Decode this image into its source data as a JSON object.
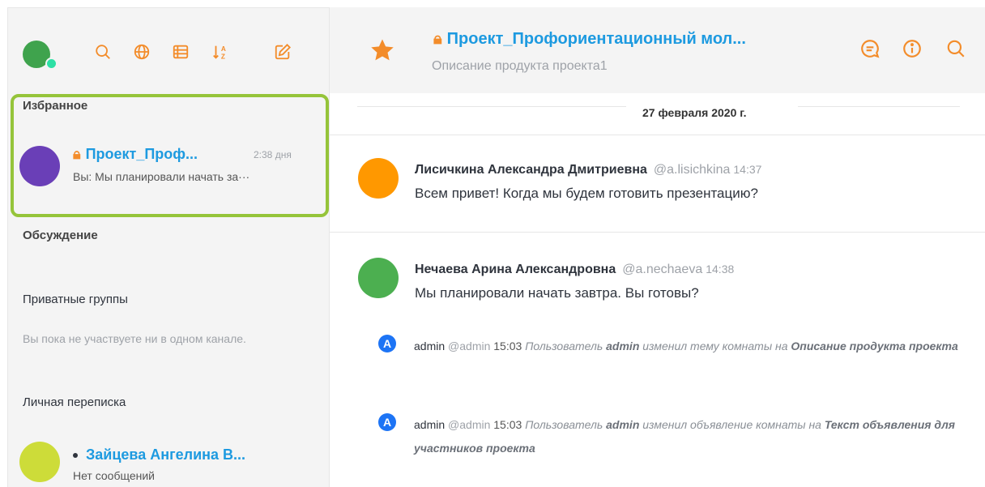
{
  "colors": {
    "accent_orange": "#f38c2a",
    "link_blue": "#1d9ae0",
    "highlight_green": "#95c43a",
    "status_green": "#2de0a5"
  },
  "sidebar": {
    "user_avatar": {
      "color": "#3fa34d",
      "status": "online"
    },
    "toolbar": [
      {
        "icon": "search-icon",
        "label": "Search"
      },
      {
        "icon": "globe-icon",
        "label": "Directory"
      },
      {
        "icon": "list-view-icon",
        "label": "Display"
      },
      {
        "icon": "sort-icon",
        "label": "Sort"
      },
      {
        "icon": "edit-icon",
        "label": "Create new"
      }
    ],
    "favorites": {
      "title": "Избранное",
      "items": [
        {
          "name": "Проект_Проф...",
          "time": "2:38 дня",
          "last_message": "Вы: Мы планировали начать за···",
          "avatar_color": "#6a3fb7",
          "private": true
        }
      ]
    },
    "discussions": {
      "title": "Обсуждение"
    },
    "private_groups": {
      "title": "Приватные группы",
      "empty_text": "Вы пока не участвуете ни в одном канале."
    },
    "direct_messages": {
      "title": "Личная переписка",
      "items": [
        {
          "name": "Зайцева Ангелина В...",
          "last_message": "Нет сообщений",
          "avatar_color": "#cddc39"
        }
      ]
    }
  },
  "main": {
    "header": {
      "title": "Проект_Профориентационный мол...",
      "topic": "Описание продукта проекта1",
      "tools": [
        {
          "icon": "discussion-icon"
        },
        {
          "icon": "info-icon"
        },
        {
          "icon": "search-icon"
        }
      ]
    },
    "date_separator": "27 февраля 2020 г.",
    "messages": [
      {
        "author": "Лисичкина Александра Дмитриевна",
        "username": "@a.lisichkina",
        "time": "14:37",
        "text": "Всем привет! Когда мы будем готовить презентацию?",
        "avatar_color": "#ff9800"
      },
      {
        "author": "Нечаева Арина Александровна",
        "username": "@a.nechaeva",
        "time": "14:38",
        "text": "Мы планировали начать завтра. Вы готовы?",
        "avatar_color": "#4caf50"
      }
    ],
    "system_messages": [
      {
        "avatar_letter": "A",
        "author": "admin",
        "username": "@admin",
        "time": "15:03",
        "pre": "Пользователь",
        "actor": "admin",
        "action": "изменил тему комнаты на",
        "value": "Описание продукта проекта"
      },
      {
        "avatar_letter": "A",
        "author": "admin",
        "username": "@admin",
        "time": "15:03",
        "pre": "Пользователь",
        "actor": "admin",
        "action": "изменил объявление комнаты на",
        "value": "Текст объявления для участников проекта"
      }
    ]
  }
}
